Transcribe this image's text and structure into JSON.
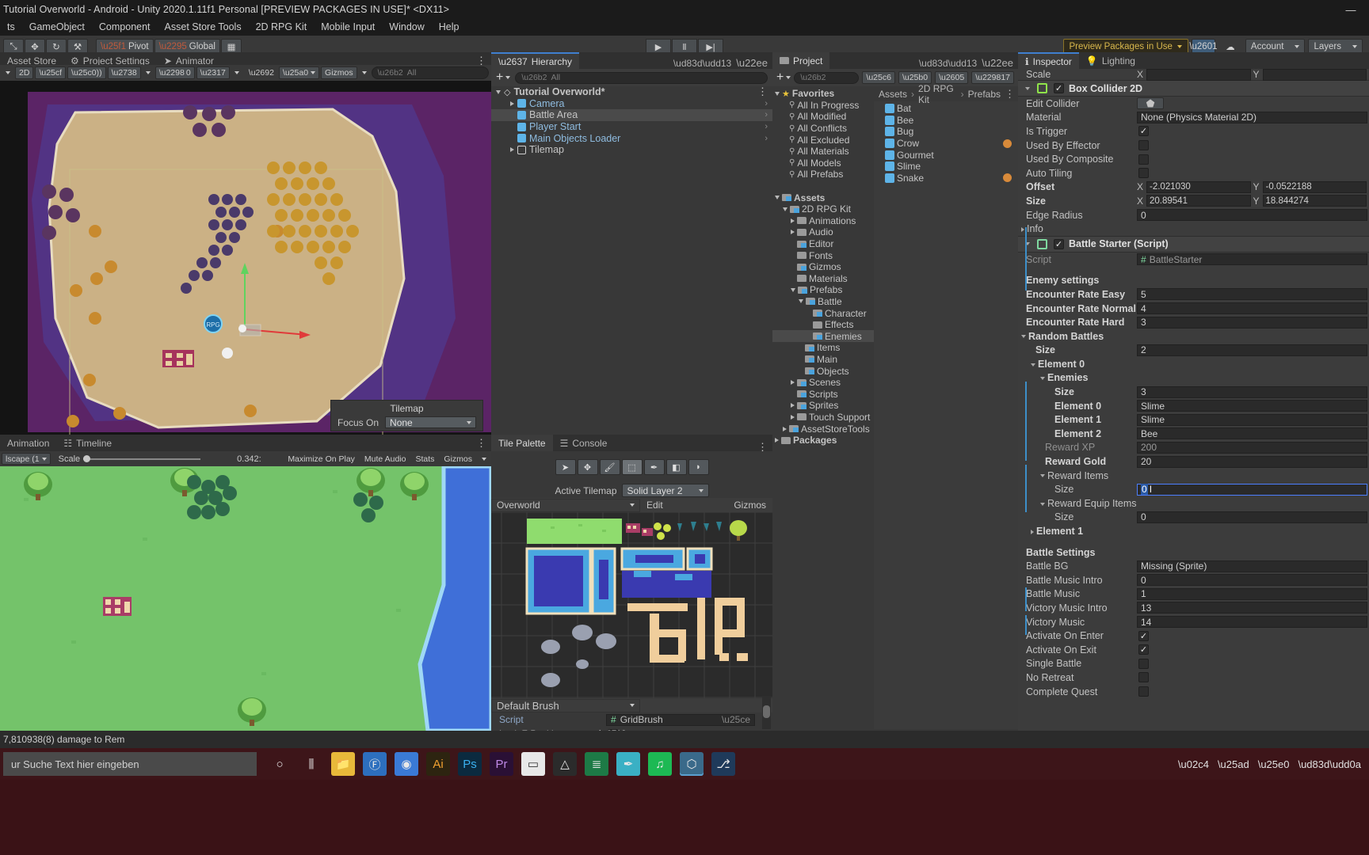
{
  "window": {
    "title": "Tutorial Overworld - Android - Unity 2020.1.11f1 Personal [PREVIEW PACKAGES IN USE]* <DX11>",
    "minimize": "—",
    "maximize": "□",
    "close": "✕"
  },
  "menubar": {
    "items": [
      "ts",
      "GameObject",
      "Component",
      "Asset Store Tools",
      "2D RPG Kit",
      "Mobile Input",
      "Window",
      "Help"
    ]
  },
  "toolbar": {
    "hand_icon": "⤡",
    "move_icon": "✥",
    "rotate_icon": "↻",
    "scale_icon": "⚒",
    "pivot_label": "Pivot",
    "global_label": "Global",
    "grid_icon": "▦",
    "play_icon": "▶",
    "pause_icon": "Ⅱ",
    "step_icon": "▶|",
    "preview_packages": "Preview Packages in Use",
    "collab_icon": "collab-icon",
    "cloud_icon": "☁",
    "account_label": "Account",
    "layers_label": "Layers"
  },
  "scene": {
    "tabs": [
      {
        "label": "Asset Store",
        "icon": ""
      },
      {
        "label": "Project Settings",
        "icon": "⚙"
      },
      {
        "label": "Animator",
        "icon": "➤"
      }
    ],
    "toolbar": {
      "mode_2d": "2D",
      "light_icon": "💡",
      "audio_icon": "🔊",
      "fx_icon": "✸",
      "hidden_count": "0",
      "grid_icon": "▦",
      "tools_icon": "⚒",
      "camera_icon": "■",
      "gizmos_label": "Gizmos",
      "search_placeholder": "All"
    },
    "tilemap_overlay": {
      "title": "Tilemap",
      "focus_label": "Focus On",
      "focus_value": "None"
    }
  },
  "gameview": {
    "tabs": [
      {
        "label": "Animation"
      },
      {
        "label": "Timeline",
        "icon": "☷"
      }
    ],
    "toolbar": {
      "aspect": "lscape (1",
      "scale_label": "Scale",
      "scale_value": "0.342:",
      "maximize": "Maximize On Play",
      "mute": "Mute Audio",
      "stats": "Stats",
      "gizmos": "Gizmos"
    }
  },
  "hierarchy": {
    "tab": "Hierarchy",
    "search_placeholder": "All",
    "add_label": "+",
    "items": [
      {
        "label": "Tutorial Overworld*",
        "depth": 0,
        "type": "scene",
        "expanded": true,
        "selected": false
      },
      {
        "label": "Camera",
        "depth": 1,
        "type": "go",
        "arrow": true,
        "blue": true,
        "chevron": true
      },
      {
        "label": "Battle Area",
        "depth": 1,
        "type": "go",
        "selected": true,
        "chevron": true
      },
      {
        "label": "Player Start",
        "depth": 1,
        "type": "go",
        "blue": true,
        "chevron": true
      },
      {
        "label": "Main Objects Loader",
        "depth": 1,
        "type": "go",
        "blue": true,
        "chevron": true
      },
      {
        "label": "Tilemap",
        "depth": 1,
        "type": "go-hollow",
        "arrow": true
      }
    ]
  },
  "tilepalette": {
    "tabs": [
      {
        "label": "Tile Palette",
        "active": true
      },
      {
        "label": "Console",
        "icon": "☰"
      }
    ],
    "tools": [
      "➤",
      "✥",
      "🖌",
      "⬚",
      "✒",
      "◧",
      "◗"
    ],
    "active_tilemap_label": "Active Tilemap",
    "active_tilemap_value": "Solid Layer 2",
    "palette_name": "Overworld",
    "edit_label": "Edit",
    "gizmos_label": "Gizmos",
    "brush_name": "Default Brush",
    "script_label": "Script",
    "script_value": "GridBrush",
    "lock_z_label": "Lock Z Position"
  },
  "project": {
    "tab": "Project",
    "search_placeholder": "",
    "hidden_count": "17",
    "breadcrumb": [
      "Assets",
      "2D RPG Kit",
      "Prefabs"
    ],
    "tree": [
      {
        "label": "Favorites",
        "depth": 0,
        "icon": "star",
        "expanded": true,
        "bold": true
      },
      {
        "label": "All In Progress",
        "depth": 1,
        "icon": "search"
      },
      {
        "label": "All Modified",
        "depth": 1,
        "icon": "search"
      },
      {
        "label": "All Conflicts",
        "depth": 1,
        "icon": "search"
      },
      {
        "label": "All Excluded",
        "depth": 1,
        "icon": "search"
      },
      {
        "label": "All Materials",
        "depth": 1,
        "icon": "search"
      },
      {
        "label": "All Models",
        "depth": 1,
        "icon": "search"
      },
      {
        "label": "All Prefabs",
        "depth": 1,
        "icon": "search"
      },
      {
        "label": "",
        "depth": 0,
        "icon": "none"
      },
      {
        "label": "Assets",
        "depth": 0,
        "icon": "folder-blue",
        "expanded": true,
        "bold": true
      },
      {
        "label": "2D RPG Kit",
        "depth": 1,
        "icon": "folder-blue",
        "expanded": true
      },
      {
        "label": "Animations",
        "depth": 2,
        "icon": "folder",
        "arrow": true
      },
      {
        "label": "Audio",
        "depth": 2,
        "icon": "folder",
        "arrow": true
      },
      {
        "label": "Editor",
        "depth": 2,
        "icon": "folder-blue"
      },
      {
        "label": "Fonts",
        "depth": 2,
        "icon": "folder"
      },
      {
        "label": "Gizmos",
        "depth": 2,
        "icon": "folder-blue"
      },
      {
        "label": "Materials",
        "depth": 2,
        "icon": "folder"
      },
      {
        "label": "Prefabs",
        "depth": 2,
        "icon": "folder-blue",
        "expanded": true
      },
      {
        "label": "Battle",
        "depth": 3,
        "icon": "folder-blue",
        "expanded": true
      },
      {
        "label": "Character",
        "depth": 4,
        "icon": "folder-blue"
      },
      {
        "label": "Effects",
        "depth": 4,
        "icon": "folder"
      },
      {
        "label": "Enemies",
        "depth": 4,
        "icon": "folder-blue",
        "selected": true
      },
      {
        "label": "Items",
        "depth": 3,
        "icon": "folder-blue"
      },
      {
        "label": "Main",
        "depth": 3,
        "icon": "folder-blue"
      },
      {
        "label": "Objects",
        "depth": 3,
        "icon": "folder-blue"
      },
      {
        "label": "Scenes",
        "depth": 2,
        "icon": "folder-blue",
        "arrow": true
      },
      {
        "label": "Scripts",
        "depth": 2,
        "icon": "folder-blue"
      },
      {
        "label": "Sprites",
        "depth": 2,
        "icon": "folder-blue",
        "arrow": true
      },
      {
        "label": "Touch Support",
        "depth": 2,
        "icon": "folder",
        "arrow": true
      },
      {
        "label": "AssetStoreTools",
        "depth": 1,
        "icon": "folder-blue",
        "arrow": true
      },
      {
        "label": "Packages",
        "depth": 0,
        "icon": "folder",
        "arrow": true,
        "bold": true
      }
    ],
    "assets": [
      {
        "label": "Bat"
      },
      {
        "label": "Bee"
      },
      {
        "label": "Bug"
      },
      {
        "label": "Crow",
        "badge": true
      },
      {
        "label": "Gourmet"
      },
      {
        "label": "Slime"
      },
      {
        "label": "Snake",
        "badge": true
      }
    ]
  },
  "inspector": {
    "tabs": [
      {
        "label": "Inspector",
        "icon": "ℹ",
        "active": true
      },
      {
        "label": "Lighting",
        "icon": "💡"
      }
    ],
    "scale_cut_label": "Scale",
    "scale_x": "X",
    "scale_y": "Y",
    "components": [
      {
        "name": "Box Collider 2D",
        "enabled": true,
        "icon_color": "#8fe34a",
        "rows": [
          {
            "label": "Edit Collider",
            "type": "button",
            "value": "⬟"
          },
          {
            "label": "Material",
            "type": "object",
            "value": "None (Physics Material 2D)"
          },
          {
            "label": "Is Trigger",
            "type": "check",
            "value": true
          },
          {
            "label": "Used By Effector",
            "type": "check",
            "value": false
          },
          {
            "label": "Used By Composite",
            "type": "check",
            "value": false
          },
          {
            "label": "Auto Tiling",
            "type": "check",
            "value": false
          },
          {
            "label": "Offset",
            "type": "vec2",
            "bold": true,
            "x": "-2.021030",
            "y": "-0.0522188"
          },
          {
            "label": "Size",
            "type": "vec2",
            "bold": true,
            "x": "20.89541",
            "y": "18.844274"
          },
          {
            "label": "Edge Radius",
            "type": "field",
            "value": "0"
          },
          {
            "label": "Info",
            "type": "foldout",
            "value": ""
          }
        ]
      },
      {
        "name": "Battle Starter (Script)",
        "enabled": true,
        "icon_color": "#7fd9a0",
        "rows": [
          {
            "label": "Script",
            "type": "object-dim",
            "value": "BattleStarter",
            "dim": true
          },
          {
            "label": "",
            "type": "spacer"
          },
          {
            "label": "Enemy settings",
            "type": "header",
            "bold": true
          },
          {
            "label": "Encounter Rate Easy",
            "type": "field",
            "bold": true,
            "value": "5"
          },
          {
            "label": "Encounter Rate Normal",
            "type": "field",
            "bold": true,
            "value": "4"
          },
          {
            "label": "Encounter Rate Hard",
            "type": "field",
            "bold": true,
            "value": "3"
          },
          {
            "label": "Random Battles",
            "type": "foldout-open",
            "bold": true,
            "indent": 0
          },
          {
            "label": "Size",
            "type": "field",
            "bold": true,
            "indent": 1,
            "value": "2"
          },
          {
            "label": "Element 0",
            "type": "foldout-open",
            "bold": true,
            "indent": 1
          },
          {
            "label": "Enemies",
            "type": "foldout-open",
            "bold": true,
            "indent": 2
          },
          {
            "label": "Size",
            "type": "field",
            "bold": true,
            "indent": 3,
            "value": "3"
          },
          {
            "label": "Element 0",
            "type": "field",
            "bold": true,
            "indent": 3,
            "value": "Slime"
          },
          {
            "label": "Element 1",
            "type": "field",
            "bold": true,
            "indent": 3,
            "value": "Slime"
          },
          {
            "label": "Element 2",
            "type": "field",
            "bold": true,
            "indent": 3,
            "value": "Bee"
          },
          {
            "label": "Reward XP",
            "type": "field",
            "dim": true,
            "indent": 2,
            "value": "200"
          },
          {
            "label": "Reward Gold",
            "type": "field",
            "bold": true,
            "indent": 2,
            "value": "20"
          },
          {
            "label": "Reward Items",
            "type": "foldout-open",
            "indent": 2
          },
          {
            "label": "Size",
            "type": "field-focus",
            "indent": 3,
            "value": "0"
          },
          {
            "label": "Reward Equip Items",
            "type": "foldout-open",
            "indent": 2
          },
          {
            "label": "Size",
            "type": "field",
            "indent": 3,
            "value": "0"
          },
          {
            "label": "Element 1",
            "type": "foldout",
            "bold": true,
            "indent": 1
          },
          {
            "label": "",
            "type": "spacer"
          },
          {
            "label": "Battle Settings",
            "type": "header",
            "bold": true
          },
          {
            "label": "Battle BG",
            "type": "object",
            "value": "Missing (Sprite)"
          },
          {
            "label": "Battle Music Intro",
            "type": "field",
            "value": "0"
          },
          {
            "label": "Battle Music",
            "type": "field",
            "value": "1"
          },
          {
            "label": "Victory Music Intro",
            "type": "field",
            "value": "13"
          },
          {
            "label": "Victory Music",
            "type": "field",
            "value": "14"
          },
          {
            "label": "Activate On Enter",
            "type": "check",
            "value": true
          },
          {
            "label": "Activate On Exit",
            "type": "check",
            "value": true
          },
          {
            "label": "Single Battle",
            "type": "check",
            "value": false
          },
          {
            "label": "No Retreat",
            "type": "check",
            "value": false
          },
          {
            "label": "Complete Quest",
            "type": "check",
            "value": false
          }
        ]
      }
    ]
  },
  "console": {
    "message": "7,810938(8) damage to Rem"
  },
  "taskbar": {
    "search_placeholder": "ur Suche Text hier eingeben",
    "icons": [
      "cortana-icon",
      "taskview-icon",
      "explorer-icon",
      "firefox-icon",
      "chrome-icon",
      "illustrator-icon",
      "photoshop-icon",
      "premiere-icon",
      "notepad-icon",
      "vlc-icon",
      "excel-icon",
      "teams-icon",
      "spotify-icon",
      "unity-icon",
      "vscode-icon"
    ],
    "tray": [
      "˄",
      "🔋",
      "📶",
      "🔊"
    ]
  },
  "colors": {
    "accent_blue": "#3d8fc9",
    "unity_panel": "#383838",
    "unity_dark": "#303030",
    "preview_gold": "#d8b74c",
    "select_blue": "#2b5ba8"
  }
}
